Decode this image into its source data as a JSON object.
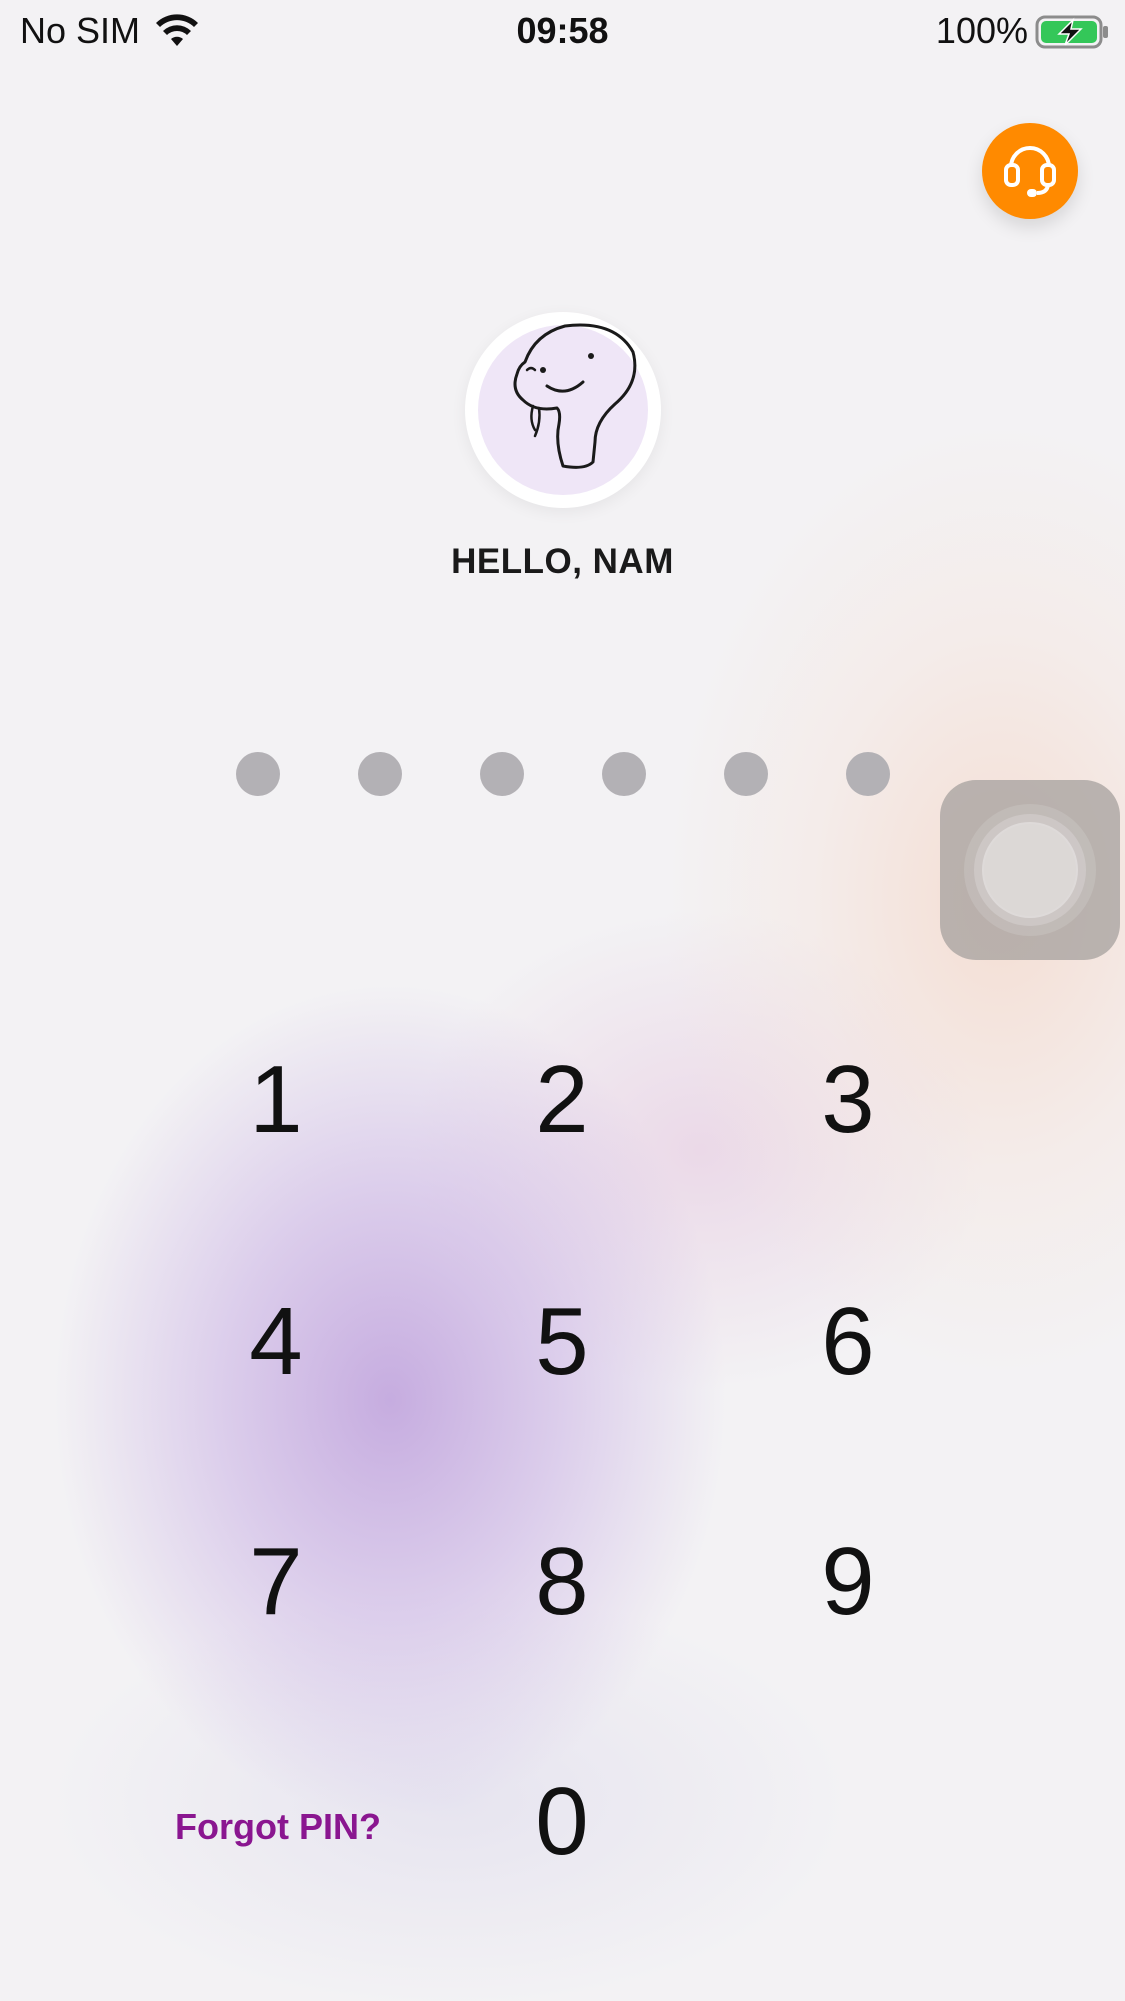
{
  "status_bar": {
    "carrier": "No SIM",
    "time": "09:58",
    "battery_percent": "100%",
    "battery_icon": "battery-charging-icon",
    "wifi_icon": "wifi-icon"
  },
  "support": {
    "icon": "headset-icon",
    "color": "#ff8a00"
  },
  "profile": {
    "avatar_icon": "dinosaur-avatar-icon",
    "greeting": "HELLO, NAM"
  },
  "pin": {
    "length": 6,
    "filled": 0
  },
  "keypad": {
    "keys": [
      "1",
      "2",
      "3",
      "4",
      "5",
      "6",
      "7",
      "8",
      "9",
      "0"
    ],
    "forgot_label": "Forgot PIN?"
  },
  "colors": {
    "accent": "#8a1690",
    "dot": "#b3b1b5",
    "support": "#ff8a00"
  }
}
